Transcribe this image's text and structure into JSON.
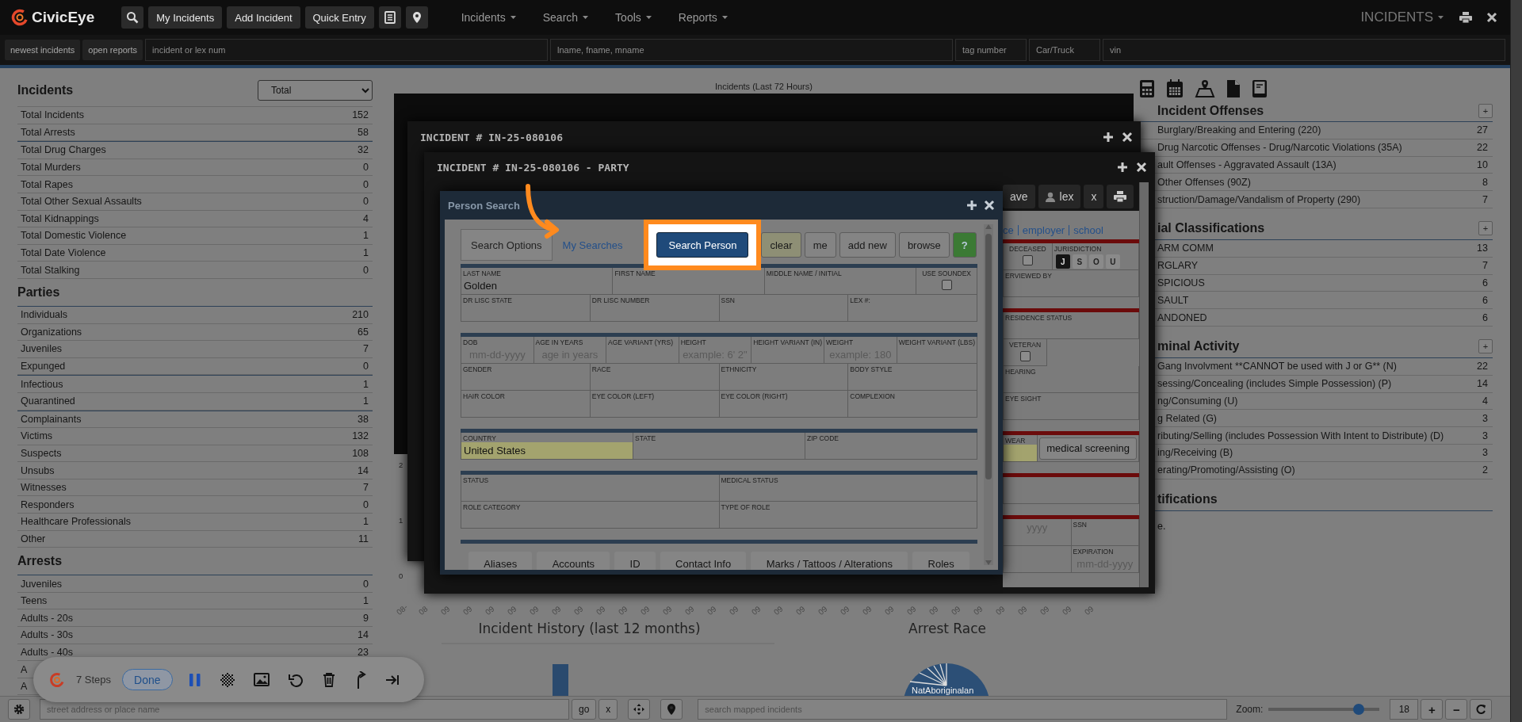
{
  "nav": {
    "logo": "CivicEye",
    "buttons": [
      "My Incidents",
      "Add Incident",
      "Quick Entry"
    ],
    "menus": [
      "Incidents",
      "Search",
      "Tools",
      "Reports"
    ],
    "module": "INCIDENTS"
  },
  "quick_search": {
    "buttons": [
      "newest incidents",
      "open reports"
    ],
    "fields": [
      {
        "placeholder": "incident or lex num"
      },
      {
        "placeholder": "lname, fname, mname"
      },
      {
        "placeholder": "tag number"
      },
      {
        "placeholder": "Car/Truck"
      },
      {
        "placeholder": "vin"
      }
    ]
  },
  "stats": {
    "sections": [
      {
        "title": "Incidents",
        "filter": "Total",
        "groups": [
          [
            {
              "label": "Total Incidents",
              "value": "152"
            },
            {
              "label": "Total Arrests",
              "value": "58"
            }
          ],
          [
            {
              "label": "Total Drug Charges",
              "value": "32"
            },
            {
              "label": "Total Murders",
              "value": "0"
            },
            {
              "label": "Total Rapes",
              "value": "0"
            },
            {
              "label": "Total Other Sexual Assaults",
              "value": "0"
            },
            {
              "label": "Total Kidnappings",
              "value": "4"
            },
            {
              "label": "Total Domestic Violence",
              "value": "1"
            },
            {
              "label": "Total Date Violence",
              "value": "1"
            },
            {
              "label": "Total Stalking",
              "value": "0"
            }
          ]
        ]
      },
      {
        "title": "Parties",
        "groups": [
          [
            {
              "label": "Individuals",
              "value": "210"
            },
            {
              "label": "Organizations",
              "value": "65"
            },
            {
              "label": "Juveniles",
              "value": "7"
            },
            {
              "label": "Expunged",
              "value": "0"
            }
          ],
          [
            {
              "label": "Infectious",
              "value": "1"
            },
            {
              "label": "Quarantined",
              "value": "1"
            }
          ],
          [
            {
              "label": "Complainants",
              "value": "38"
            },
            {
              "label": "Victims",
              "value": "132"
            },
            {
              "label": "Suspects",
              "value": "108"
            },
            {
              "label": "Unsubs",
              "value": "14"
            },
            {
              "label": "Witnesses",
              "value": "7"
            },
            {
              "label": "Responders",
              "value": "0"
            },
            {
              "label": "Healthcare Professionals",
              "value": "1"
            },
            {
              "label": "Other",
              "value": "11"
            }
          ]
        ]
      },
      {
        "title": "Arrests",
        "groups": [
          [
            {
              "label": "Juveniles",
              "value": "0"
            },
            {
              "label": "Teens",
              "value": "1"
            },
            {
              "label": "Adults - 20s",
              "value": "9"
            },
            {
              "label": "Adults - 30s",
              "value": "14"
            },
            {
              "label": "Adults - 40s",
              "value": "23"
            },
            {
              "label": "A"
            },
            {
              "label": "A"
            }
          ]
        ]
      }
    ]
  },
  "center": {
    "chart_title": "Incidents (Last 72 Hours)",
    "y_ticks": [
      "2",
      "1",
      "0"
    ],
    "x_labels": [
      "08-",
      "08",
      "09",
      "09",
      "09",
      "09",
      "09",
      "09",
      "09",
      "09",
      "09",
      "09",
      "09",
      "09",
      "09",
      "09",
      "09",
      "09",
      "09",
      "09",
      "09",
      "09",
      "09",
      "09",
      "09",
      "09",
      "09",
      "09",
      "09",
      "09",
      "09",
      "09"
    ],
    "history_title": "Incident History (last 12 months)",
    "race_title": "Arrest Race",
    "race_label": "NatAboriginalan"
  },
  "right": {
    "sections": [
      {
        "title": "Incident Offenses",
        "add": "+",
        "rows": [
          {
            "label": "Burglary/Breaking and Entering (220)",
            "value": "27"
          },
          {
            "label": "Drug Narcotic Offenses - Drug/Narcotic Violations (35A)",
            "value": "22"
          },
          {
            "label": "ault Offenses - Aggravated Assault (13A)",
            "value": "10"
          },
          {
            "label": "Other Offenses (90Z)",
            "value": "8"
          },
          {
            "label": "struction/Damage/Vandalism of Property (290)",
            "value": "7"
          }
        ]
      },
      {
        "title": "ial Classifications",
        "add": "+",
        "rows": [
          {
            "label": "ARM COMM",
            "value": "13"
          },
          {
            "label": "RGLARY",
            "value": "7"
          },
          {
            "label": "SPICIOUS",
            "value": "6"
          },
          {
            "label": "SAULT",
            "value": "6"
          },
          {
            "label": "ANDONED",
            "value": "6"
          }
        ]
      },
      {
        "title": "minal Activity",
        "add": "+",
        "rows": [
          {
            "label": "Gang Involvment **CANNOT be used with J or G** (N)",
            "value": "22"
          },
          {
            "label": "sessing/Concealing (includes Simple Possession) (P)",
            "value": "14"
          },
          {
            "label": "ng/Consuming (U)",
            "value": "4"
          },
          {
            "label": "g Related (G)",
            "value": "3"
          },
          {
            "label": "ributing/Selling (includes Possession With Intent to Distribute) (D)",
            "value": "3"
          },
          {
            "label": "ing/Receiving (B)",
            "value": "3"
          },
          {
            "label": "erating/Promoting/Assisting (O)",
            "value": "2"
          }
        ]
      },
      {
        "title": "tifications",
        "note": "e."
      }
    ]
  },
  "incident_window": {
    "title": "INCIDENT # IN-25-080106"
  },
  "party_window": {
    "title": "INCIDENT # IN-25-080106 - PARTY",
    "toolbar": [
      {
        "kind": "text",
        "label": "ave"
      },
      {
        "kind": "user",
        "label": "lex"
      },
      {
        "kind": "text",
        "label": "x"
      },
      {
        "kind": "print"
      }
    ],
    "links": [
      "ce",
      "employer",
      "school"
    ],
    "blocks": [
      {
        "rows": [
          [
            {
              "kind": "checkbox",
              "label": "DECEASED",
              "checked": false
            },
            {
              "kind": "choice",
              "label": "JURISDICTION",
              "options": [
                {
                  "label": "J",
                  "selected": true
                },
                {
                  "label": "S",
                  "selected": false
                },
                {
                  "label": "O",
                  "selected": false
                },
                {
                  "label": "U",
                  "selected": false
                }
              ]
            }
          ],
          [
            {
              "kind": "text",
              "label": "ERVIEWED BY"
            }
          ]
        ]
      },
      {
        "rows": [
          [
            {
              "kind": "text",
              "label": "RESIDENCE STATUS"
            }
          ],
          [
            {
              "kind": "checkbox",
              "label": "VETERAN",
              "checked": false
            }
          ],
          [
            {
              "kind": "text",
              "label": "HEARING"
            }
          ],
          [
            {
              "kind": "text",
              "label": "EYE SIGHT"
            }
          ]
        ]
      },
      {
        "rows": [
          [
            {
              "kind": "text",
              "label": "WEAR",
              "highlighted": true
            },
            {
              "kind": "button",
              "label": "medical screening"
            }
          ]
        ]
      },
      {
        "rows": [
          [
            {
              "kind": "text"
            }
          ]
        ]
      },
      {
        "rows": [
          [
            {
              "kind": "text",
              "placeholder": "yyyy"
            },
            {
              "kind": "text",
              "label": "SSN"
            }
          ],
          [
            {
              "kind": "text"
            },
            {
              "kind": "text",
              "label": "EXPIRATION",
              "placeholder": "mm-dd-yyyy"
            }
          ]
        ]
      }
    ]
  },
  "person_search": {
    "title": "Person Search",
    "tabs": [
      {
        "label": "Search Options",
        "selected": true
      },
      {
        "label": "My Searches",
        "selected": false
      }
    ],
    "buttons": [
      {
        "kind": "primary",
        "label": "Search Person",
        "highlighted": true
      },
      {
        "kind": "clear",
        "label": "clear"
      },
      {
        "kind": "default",
        "label": "me"
      },
      {
        "kind": "default",
        "label": "add new"
      },
      {
        "kind": "default",
        "label": "browse"
      },
      {
        "kind": "help",
        "label": "?"
      }
    ],
    "sections": [
      {
        "rows": [
          [
            {
              "kind": "text",
              "label": "LAST NAME",
              "value": "Golden"
            },
            {
              "kind": "text",
              "label": "FIRST NAME"
            },
            {
              "kind": "text",
              "label": "MIDDLE NAME / INITIAL"
            },
            {
              "kind": "checkbox",
              "label": "USE SOUNDEX",
              "checked": false
            }
          ],
          [
            {
              "kind": "text",
              "label": "DR LISC STATE"
            },
            {
              "kind": "text",
              "label": "DR LISC NUMBER"
            },
            {
              "kind": "text",
              "label": "SSN"
            },
            {
              "kind": "text",
              "label": "LEX #:"
            }
          ]
        ]
      },
      {
        "rows": [
          [
            {
              "kind": "text",
              "label": "DOB",
              "placeholder": "mm-dd-yyyy"
            },
            {
              "kind": "text",
              "label": "AGE IN YEARS",
              "placeholder": "age in years"
            },
            {
              "kind": "text",
              "label": "AGE VARIANT (YRS)"
            },
            {
              "kind": "text",
              "label": "HEIGHT",
              "placeholder": "example: 6' 2\""
            },
            {
              "kind": "text",
              "label": "HEIGHT VARIANT (IN)"
            },
            {
              "kind": "text",
              "label": "WEIGHT",
              "placeholder": "example: 180"
            },
            {
              "kind": "text",
              "label": "WEIGHT VARIANT (LBS)"
            }
          ],
          [
            {
              "kind": "text",
              "label": "GENDER"
            },
            {
              "kind": "text",
              "label": "RACE"
            },
            {
              "kind": "text",
              "label": "ETHNICITY"
            },
            {
              "kind": "text",
              "label": "BODY STYLE"
            }
          ],
          [
            {
              "kind": "text",
              "label": "HAIR COLOR"
            },
            {
              "kind": "text",
              "label": "EYE COLOR (LEFT)"
            },
            {
              "kind": "text",
              "label": "EYE COLOR (RIGHT)"
            },
            {
              "kind": "text",
              "label": "COMPLEXION"
            }
          ]
        ]
      },
      {
        "rows": [
          [
            {
              "kind": "text",
              "label": "COUNTRY",
              "value": "United States",
              "highlighted": true
            },
            {
              "kind": "text",
              "label": "STATE"
            },
            {
              "kind": "text",
              "label": "ZIP CODE"
            }
          ]
        ]
      },
      {
        "rows": [
          [
            {
              "kind": "text",
              "label": "STATUS"
            },
            {
              "kind": "text",
              "label": "MEDICAL STATUS"
            }
          ],
          [
            {
              "kind": "text",
              "label": "ROLE CATEGORY"
            },
            {
              "kind": "text",
              "label": "TYPE OF ROLE"
            }
          ]
        ]
      }
    ],
    "subtabs": [
      "Aliases",
      "Accounts",
      "ID",
      "Contact Info",
      "Marks / Tattoos / Alterations",
      "Roles"
    ]
  },
  "recorder": {
    "steps": "7 Steps",
    "done": "Done"
  },
  "bottom_bar": {
    "address_placeholder": "street address or place name",
    "go": "go",
    "clear": "x",
    "search_placeholder": "search mapped incidents",
    "zoom_label": "Zoom:",
    "zoom": {
      "level": 0.85,
      "value": "18"
    },
    "zoom_in": "+",
    "zoom_out": "−"
  }
}
